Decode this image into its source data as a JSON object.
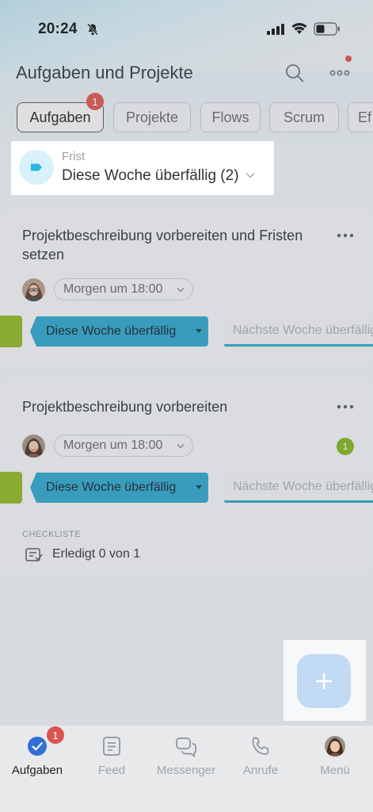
{
  "status_bar": {
    "time": "20:24"
  },
  "header": {
    "title": "Aufgaben und Projekte"
  },
  "tabs": [
    {
      "label": "Aufgaben",
      "active": true,
      "badge": "1"
    },
    {
      "label": "Projekte"
    },
    {
      "label": "Flows"
    },
    {
      "label": "Scrum"
    },
    {
      "label": "Ef"
    }
  ],
  "filter": {
    "label": "Frist",
    "value": "Diese Woche überfällig (2)"
  },
  "tasks": [
    {
      "title": "Projektbeschreibung vorbereiten und Fristen setzen",
      "deadline": "Morgen um 18:00",
      "stage_current": "Diese Woche überfällig",
      "stage_next": "Nächste Woche überfällig"
    },
    {
      "title": "Projektbeschreibung vorbereiten",
      "deadline": "Morgen um 18:00",
      "stage_current": "Diese Woche überfällig",
      "stage_next": "Nächste Woche überfällig",
      "counter": "1",
      "checklist_label": "CHECKLISTE",
      "checklist_text": "Erledigt 0 von 1"
    }
  ],
  "bottom_nav": [
    {
      "label": "Aufgaben",
      "icon": "check-circle-icon",
      "active": true,
      "badge": "1"
    },
    {
      "label": "Feed",
      "icon": "feed-icon"
    },
    {
      "label": "Messenger",
      "icon": "chat-icon"
    },
    {
      "label": "Anrufe",
      "icon": "phone-icon"
    },
    {
      "label": "Menü",
      "icon": "avatar-icon"
    }
  ],
  "colors": {
    "accent": "#2da3c8",
    "badge_red": "#d9534f",
    "stage_green": "#8db520",
    "nav_active": "#2f6fd6"
  }
}
